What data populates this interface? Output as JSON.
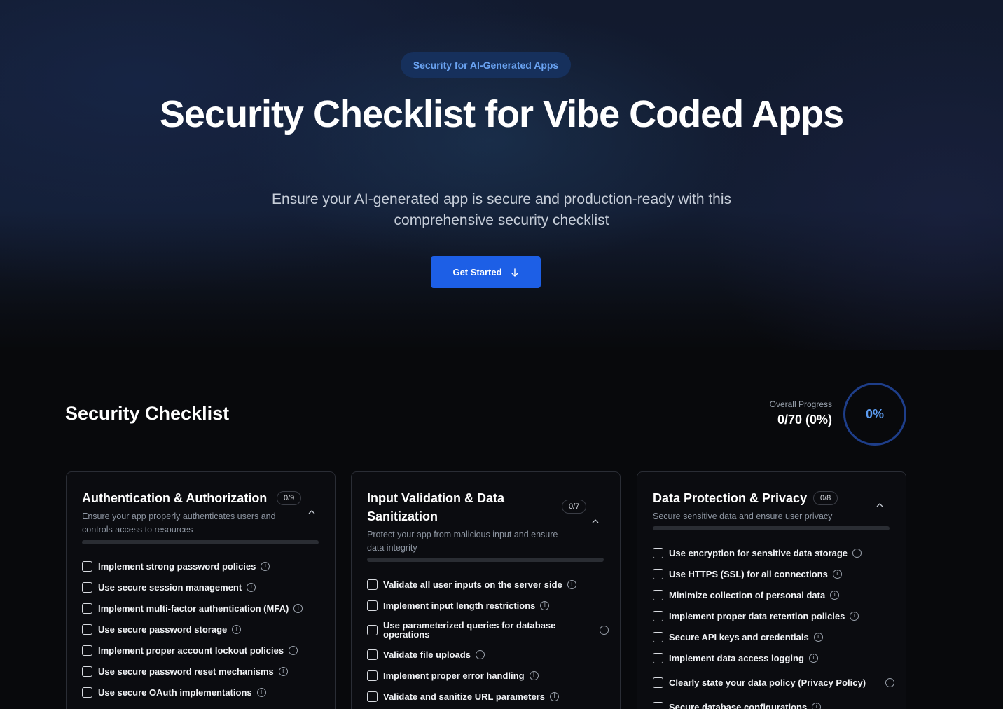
{
  "hero": {
    "badge": "Security for AI-Generated Apps",
    "title": "Security Checklist for Vibe Coded Apps",
    "subtitle": "Ensure your AI-generated app is secure and production-ready with this comprehensive security checklist",
    "cta_label": "Get Started"
  },
  "checklist": {
    "title": "Security Checklist",
    "overall_label": "Overall Progress",
    "overall_value": "0/70 (0%)",
    "overall_percent": "0%"
  },
  "cards": [
    {
      "title": "Authentication & Authorization",
      "count": "0/9",
      "description": "Ensure your app properly authenticates users and controls access to resources",
      "progress": 0,
      "items": [
        "Implement strong password policies",
        "Use secure session management",
        "Implement multi-factor authentication (MFA)",
        "Use secure password storage",
        "Implement proper account lockout policies",
        "Use secure password reset mechanisms",
        "Use secure OAuth implementations"
      ]
    },
    {
      "title": "Input Validation & Data Sanitization",
      "count": "0/7",
      "description": "Protect your app from malicious input and ensure data integrity",
      "progress": 0,
      "items": [
        "Validate all user inputs on the server side",
        "Implement input length restrictions",
        "Use parameterized queries for database operations",
        "Validate file uploads",
        "Implement proper error handling",
        "Validate and sanitize URL parameters"
      ]
    },
    {
      "title": "Data Protection & Privacy",
      "count": "0/8",
      "description": "Secure sensitive data and ensure user privacy",
      "progress": 0,
      "items": [
        "Use encryption for sensitive data storage",
        "Use HTTPS (SSL) for all connections",
        "Minimize collection of personal data",
        "Implement proper data retention policies",
        "Secure API keys and credentials",
        "Implement data access logging",
        "Clearly state your data policy (Privacy Policy)",
        "Secure database configurations"
      ]
    }
  ]
}
